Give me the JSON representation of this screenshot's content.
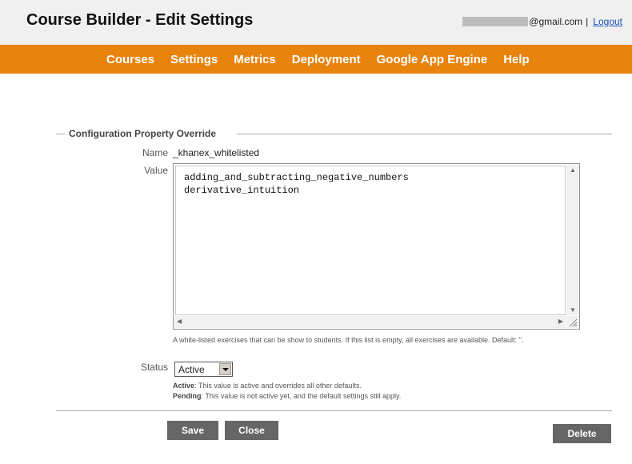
{
  "header": {
    "title": "Course Builder - Edit Settings",
    "email_domain": "@gmail.com",
    "separator": "|",
    "logout": "Logout"
  },
  "nav": {
    "items": [
      "Courses",
      "Settings",
      "Metrics",
      "Deployment",
      "Google App Engine",
      "Help"
    ]
  },
  "form": {
    "legend": "Configuration Property Override",
    "name_label": "Name",
    "name_value": "_khanex_whitelisted",
    "value_label": "Value",
    "value_text": "adding_and_subtracting_negative_numbers\nderivative_intuition",
    "help_text": "A white-listed exercises that can be show to students. If this list is empty, all exercises are available. Default: ''.",
    "status_label": "Status",
    "status_selected": "Active",
    "status_help": {
      "active_term": "Active",
      "active_desc": ": This value is active and overrides all other defaults.",
      "pending_term": "Pending",
      "pending_desc": ": This value is not active yet, and the default settings still apply."
    }
  },
  "buttons": {
    "save": "Save",
    "close": "Close",
    "delete": "Delete"
  },
  "colors": {
    "nav_bg": "#e8830e",
    "button_bg": "#666666",
    "header_bg": "#f0f0f0"
  }
}
